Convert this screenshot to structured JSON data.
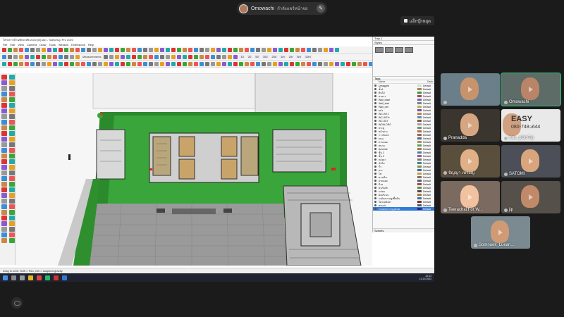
{
  "meeting": {
    "presenter_name": "Omowachi",
    "presenter_status": "กำลังแชร์หน้าจอ",
    "record_label": "แล็กบุ๊กหยุด"
  },
  "app": {
    "window_title": "โครงการบ้านพักอาศัย 2020 (B).skb - SketchUp Pro 2020",
    "menu": [
      "File",
      "Edit",
      "View",
      "Camera",
      "Draw",
      "Tools",
      "Window",
      "Extensions",
      "Help"
    ],
    "measurements_label": "Measurements",
    "toolbar_values": [
      "10",
      "20",
      "50",
      "100",
      "200",
      "1m",
      "2m",
      "5m",
      "10m"
    ],
    "status_text": "Drag in orbit. Shift = Pan, Ctrl = suspend gravity",
    "tray": {
      "default_tray": "Tray 1",
      "styles_panel": "Styles",
      "tags_panel": "Tags",
      "scenes_panel": "Scenes",
      "col_name": "Name",
      "col_dash": "Dash",
      "tags": [
        {
          "name": "Untagged",
          "dash": "Default",
          "color": "#d8d8d8"
        },
        {
          "name": "ชั้น1",
          "dash": "Default",
          "color": "#9c8a4d"
        },
        {
          "name": "ต้นไม้",
          "dash": "Default",
          "color": "#3f8f3f"
        },
        {
          "name": "อาคาร",
          "dash": "Default",
          "color": "#a34a4a"
        },
        {
          "name": "Wall_base",
          "dash": "Default",
          "color": "#6b6bb0"
        },
        {
          "name": "Wall_slab",
          "dash": "Default",
          "color": "#7f7f7f"
        },
        {
          "name": "Wall_ceil",
          "dash": "Default",
          "color": "#b0b060"
        },
        {
          "name": "ผนัง",
          "dash": "Default",
          "color": "#7b4fa0"
        },
        {
          "name": "WC-WT1",
          "dash": "Default",
          "color": "#c08040"
        },
        {
          "name": "WC-WT%",
          "dash": "Default",
          "color": "#5a8fc0"
        },
        {
          "name": "WC-SKT",
          "dash": "Default",
          "color": "#8a5a3a"
        },
        {
          "name": "WDW-DRG",
          "dash": "Default",
          "color": "#a0a0a0"
        },
        {
          "name": "ประตู",
          "dash": "Default",
          "color": "#6a9a6a"
        },
        {
          "name": "หน้าต่าง",
          "dash": "Default",
          "color": "#c06060"
        },
        {
          "name": "ราวกันตก",
          "dash": "Default",
          "color": "#907040"
        },
        {
          "name": "ถนน",
          "dash": "Default",
          "color": "#6060a0"
        },
        {
          "name": "ลานจอด",
          "dash": "Default",
          "color": "#9a9a5a"
        },
        {
          "name": "สนาม",
          "dash": "Default",
          "color": "#5aa05a"
        },
        {
          "name": "Amenite",
          "dash": "Default",
          "color": "#b07a40"
        },
        {
          "name": "ชั้น 2",
          "dash": "Default",
          "color": "#4a7ab0"
        },
        {
          "name": "ชั้น 3",
          "dash": "Default",
          "color": "#a05a8a"
        },
        {
          "name": "หลังคา",
          "dash": "Default",
          "color": "#7a7a7a"
        },
        {
          "name": "บันได",
          "dash": "Default",
          "color": "#3a8a8a"
        },
        {
          "name": "รั้ว",
          "dash": "Default",
          "color": "#8a8a3a"
        },
        {
          "name": "สระ",
          "dash": "Default",
          "color": "#3a6aa0"
        },
        {
          "name": "ไฟ",
          "dash": "Default",
          "color": "#c0a040"
        },
        {
          "name": "ทางเดิน",
          "dash": "Default",
          "color": "#8a6a5a"
        },
        {
          "name": "ลาดจอด",
          "dash": "Default",
          "color": "#5a5a8a"
        },
        {
          "name": "ป้าย",
          "dash": "Default",
          "color": "#9a4a4a"
        },
        {
          "name": "ครุภัณฑ์",
          "dash": "Default",
          "color": "#6a8a4a"
        },
        {
          "name": "แปลน",
          "dash": "Default",
          "color": "#4a4a4a"
        },
        {
          "name": "ผังบริเวณ",
          "dash": "Default",
          "color": "#aa7a2a"
        },
        {
          "name": "ระดับความสูงพื้นดิน",
          "dash": "Default",
          "color": "#2a7aaa"
        },
        {
          "name": "โครงหลังคา",
          "dash": "Default",
          "color": "#8a2a2a"
        },
        {
          "name": "ตกแต่ง",
          "dash": "Default",
          "color": "#555555"
        },
        {
          "name": "ระบบสาธารณูปโภค",
          "dash": "Default",
          "color": "#2a2a8a"
        }
      ]
    },
    "clock": {
      "time": "15:43",
      "date": "11/12/2563"
    }
  },
  "participants": [
    {
      "name": "",
      "bg": "#6a7f8a",
      "skin": "#c7936d"
    },
    {
      "name": "Omowachi",
      "bg": "#5d6c66",
      "skin": "#b98467",
      "active": true
    },
    {
      "name": "Pranadda",
      "bg": "#3b3530",
      "skin": "#d6a682"
    },
    {
      "name": "KaL..pOmTip",
      "bg": "#e9e9e9",
      "skin": "#d0a080",
      "overlay_text": "EASY",
      "overlay_phone": "080-7486644"
    },
    {
      "name": "ปัญญา เหรยญ",
      "bg": "#5a4e3c",
      "skin": "#e0b087"
    },
    {
      "name": "SATOMI",
      "bg": "#4c4f57",
      "skin": "#d9a57c"
    },
    {
      "name": "Teerachai:For W...",
      "bg": "#7a6a60",
      "skin": "#f2c2a0"
    },
    {
      "name": "jip",
      "bg": "#555049",
      "skin": "#c08a6a"
    },
    {
      "name": "Somnuek_Luean...",
      "bg": "#7a8a90",
      "skin": "#cf9a74"
    }
  ]
}
